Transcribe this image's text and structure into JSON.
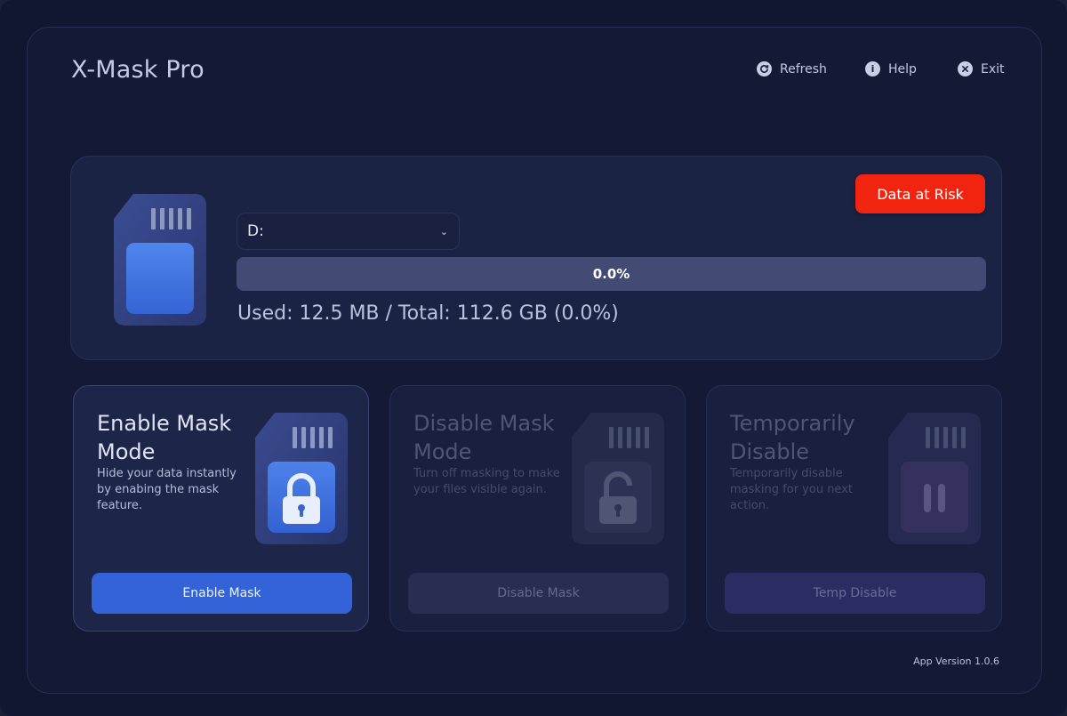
{
  "app": {
    "title": "X-Mask Pro",
    "version": "App Version 1.0.6"
  },
  "toolbar": {
    "refresh_label": "Refresh",
    "help_label": "Help",
    "exit_label": "Exit"
  },
  "drive": {
    "selected": "D:",
    "status_label": "Data at Risk",
    "progress_value": 0.0,
    "progress_text": "0.0%",
    "usage_text": "Used: 12.5 MB / Total: 112.6 GB (0.0%)"
  },
  "cards": [
    {
      "title": "Enable Mask Mode",
      "description": "Hide your data instantly by enabing the mask feature.",
      "button_label": "Enable Mask",
      "icon": "lock-closed-icon"
    },
    {
      "title": "Disable Mask Mode",
      "description": "Turn off masking to make your files visible again.",
      "button_label": "Disable Mask",
      "icon": "lock-open-icon"
    },
    {
      "title": "Temporarily Disable",
      "description": "Temporarily disable masking for you next action.",
      "button_label": "Temp Disable",
      "icon": "pause-icon"
    }
  ],
  "colors": {
    "accent": "#3463d9",
    "danger": "#f0240f",
    "background": "#141a36"
  }
}
